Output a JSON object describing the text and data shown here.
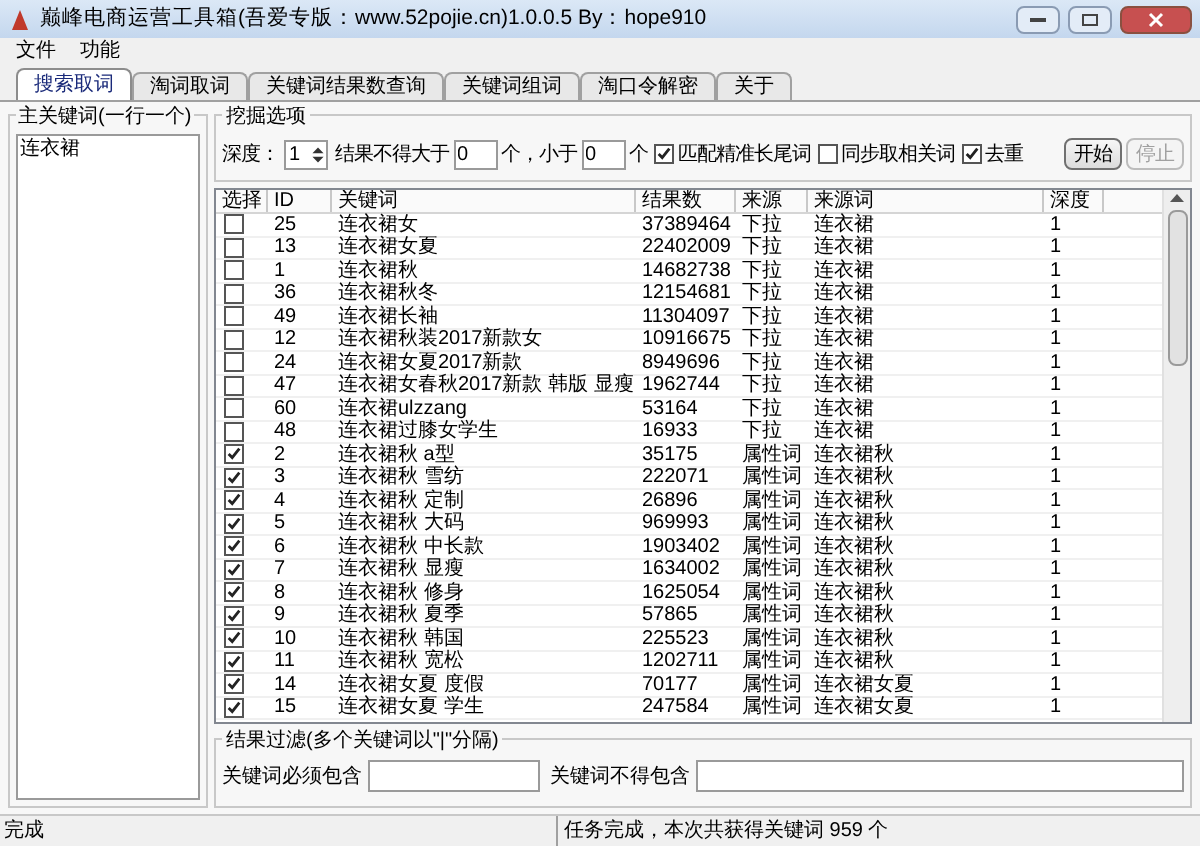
{
  "window": {
    "title": "巅峰电商运营工具箱(吾爱专版：www.52pojie.cn)1.0.0.5 By：hope910"
  },
  "menu": [
    "文件",
    "功能"
  ],
  "tabs": [
    {
      "label": "搜索取词",
      "selected": true
    },
    {
      "label": "淘词取词",
      "selected": false
    },
    {
      "label": "关键词结果数查询",
      "selected": false
    },
    {
      "label": "关键词组词",
      "selected": false
    },
    {
      "label": "淘口令解密",
      "selected": false
    },
    {
      "label": "关于",
      "selected": false
    }
  ],
  "main_keywords": {
    "title": "主关键词(一行一个)",
    "value": "连衣裙"
  },
  "options": {
    "title": "挖掘选项",
    "depth_label": "深度：",
    "depth_value": "1",
    "max_label": "结果不得大于",
    "max_value": "0",
    "max_unit": "个，小于",
    "min_value": "0",
    "min_unit": "个",
    "checkboxes": [
      {
        "label": "匹配精准长尾词",
        "checked": true
      },
      {
        "label": "同步取相关词",
        "checked": false
      },
      {
        "label": "去重",
        "checked": true
      }
    ],
    "buttons": [
      {
        "label": "开始",
        "disabled": false
      },
      {
        "label": "停止",
        "disabled": true
      }
    ]
  },
  "table": {
    "columns": [
      "选择",
      "ID",
      "关键词",
      "结果数",
      "来源",
      "来源词",
      "深度"
    ],
    "rows": [
      {
        "checked": false,
        "id": "25",
        "keyword": "连衣裙女",
        "results": "37389464",
        "source": "下拉",
        "source_word": "连衣裙",
        "depth": "1"
      },
      {
        "checked": false,
        "id": "13",
        "keyword": "连衣裙女夏",
        "results": "22402009",
        "source": "下拉",
        "source_word": "连衣裙",
        "depth": "1"
      },
      {
        "checked": false,
        "id": "1",
        "keyword": "连衣裙秋",
        "results": "14682738",
        "source": "下拉",
        "source_word": "连衣裙",
        "depth": "1"
      },
      {
        "checked": false,
        "id": "36",
        "keyword": "连衣裙秋冬",
        "results": "12154681",
        "source": "下拉",
        "source_word": "连衣裙",
        "depth": "1"
      },
      {
        "checked": false,
        "id": "49",
        "keyword": "连衣裙长袖",
        "results": "11304097",
        "source": "下拉",
        "source_word": "连衣裙",
        "depth": "1"
      },
      {
        "checked": false,
        "id": "12",
        "keyword": "连衣裙秋装2017新款女",
        "results": "10916675",
        "source": "下拉",
        "source_word": "连衣裙",
        "depth": "1"
      },
      {
        "checked": false,
        "id": "24",
        "keyword": "连衣裙女夏2017新款",
        "results": "8949696",
        "source": "下拉",
        "source_word": "连衣裙",
        "depth": "1"
      },
      {
        "checked": false,
        "id": "47",
        "keyword": "连衣裙女春秋2017新款 韩版 显瘦",
        "results": "1962744",
        "source": "下拉",
        "source_word": "连衣裙",
        "depth": "1"
      },
      {
        "checked": false,
        "id": "60",
        "keyword": "连衣裙ulzzang",
        "results": "53164",
        "source": "下拉",
        "source_word": "连衣裙",
        "depth": "1"
      },
      {
        "checked": false,
        "id": "48",
        "keyword": "连衣裙过膝女学生",
        "results": "16933",
        "source": "下拉",
        "source_word": "连衣裙",
        "depth": "1"
      },
      {
        "checked": true,
        "id": "2",
        "keyword": "连衣裙秋 a型",
        "results": "35175",
        "source": "属性词",
        "source_word": "连衣裙秋",
        "depth": "1"
      },
      {
        "checked": true,
        "id": "3",
        "keyword": "连衣裙秋 雪纺",
        "results": "222071",
        "source": "属性词",
        "source_word": "连衣裙秋",
        "depth": "1"
      },
      {
        "checked": true,
        "id": "4",
        "keyword": "连衣裙秋 定制",
        "results": "26896",
        "source": "属性词",
        "source_word": "连衣裙秋",
        "depth": "1"
      },
      {
        "checked": true,
        "id": "5",
        "keyword": "连衣裙秋 大码",
        "results": "969993",
        "source": "属性词",
        "source_word": "连衣裙秋",
        "depth": "1"
      },
      {
        "checked": true,
        "id": "6",
        "keyword": "连衣裙秋 中长款",
        "results": "1903402",
        "source": "属性词",
        "source_word": "连衣裙秋",
        "depth": "1"
      },
      {
        "checked": true,
        "id": "7",
        "keyword": "连衣裙秋 显瘦",
        "results": "1634002",
        "source": "属性词",
        "source_word": "连衣裙秋",
        "depth": "1"
      },
      {
        "checked": true,
        "id": "8",
        "keyword": "连衣裙秋 修身",
        "results": "1625054",
        "source": "属性词",
        "source_word": "连衣裙秋",
        "depth": "1"
      },
      {
        "checked": true,
        "id": "9",
        "keyword": "连衣裙秋 夏季",
        "results": "57865",
        "source": "属性词",
        "source_word": "连衣裙秋",
        "depth": "1"
      },
      {
        "checked": true,
        "id": "10",
        "keyword": "连衣裙秋 韩国",
        "results": "225523",
        "source": "属性词",
        "source_word": "连衣裙秋",
        "depth": "1"
      },
      {
        "checked": true,
        "id": "11",
        "keyword": "连衣裙秋 宽松",
        "results": "1202711",
        "source": "属性词",
        "source_word": "连衣裙秋",
        "depth": "1"
      },
      {
        "checked": true,
        "id": "14",
        "keyword": "连衣裙女夏 度假",
        "results": "70177",
        "source": "属性词",
        "source_word": "连衣裙女夏",
        "depth": "1"
      },
      {
        "checked": true,
        "id": "15",
        "keyword": "连衣裙女夏 学生",
        "results": "247584",
        "source": "属性词",
        "source_word": "连衣裙女夏",
        "depth": "1"
      }
    ]
  },
  "filter": {
    "title": "结果过滤(多个关键词以\"|\"分隔)",
    "include_label": "关键词必须包含",
    "exclude_label": "关键词不得包含"
  },
  "status_bar": {
    "left": "完成",
    "right": "任务完成，本次共获得关键词 959 个"
  }
}
